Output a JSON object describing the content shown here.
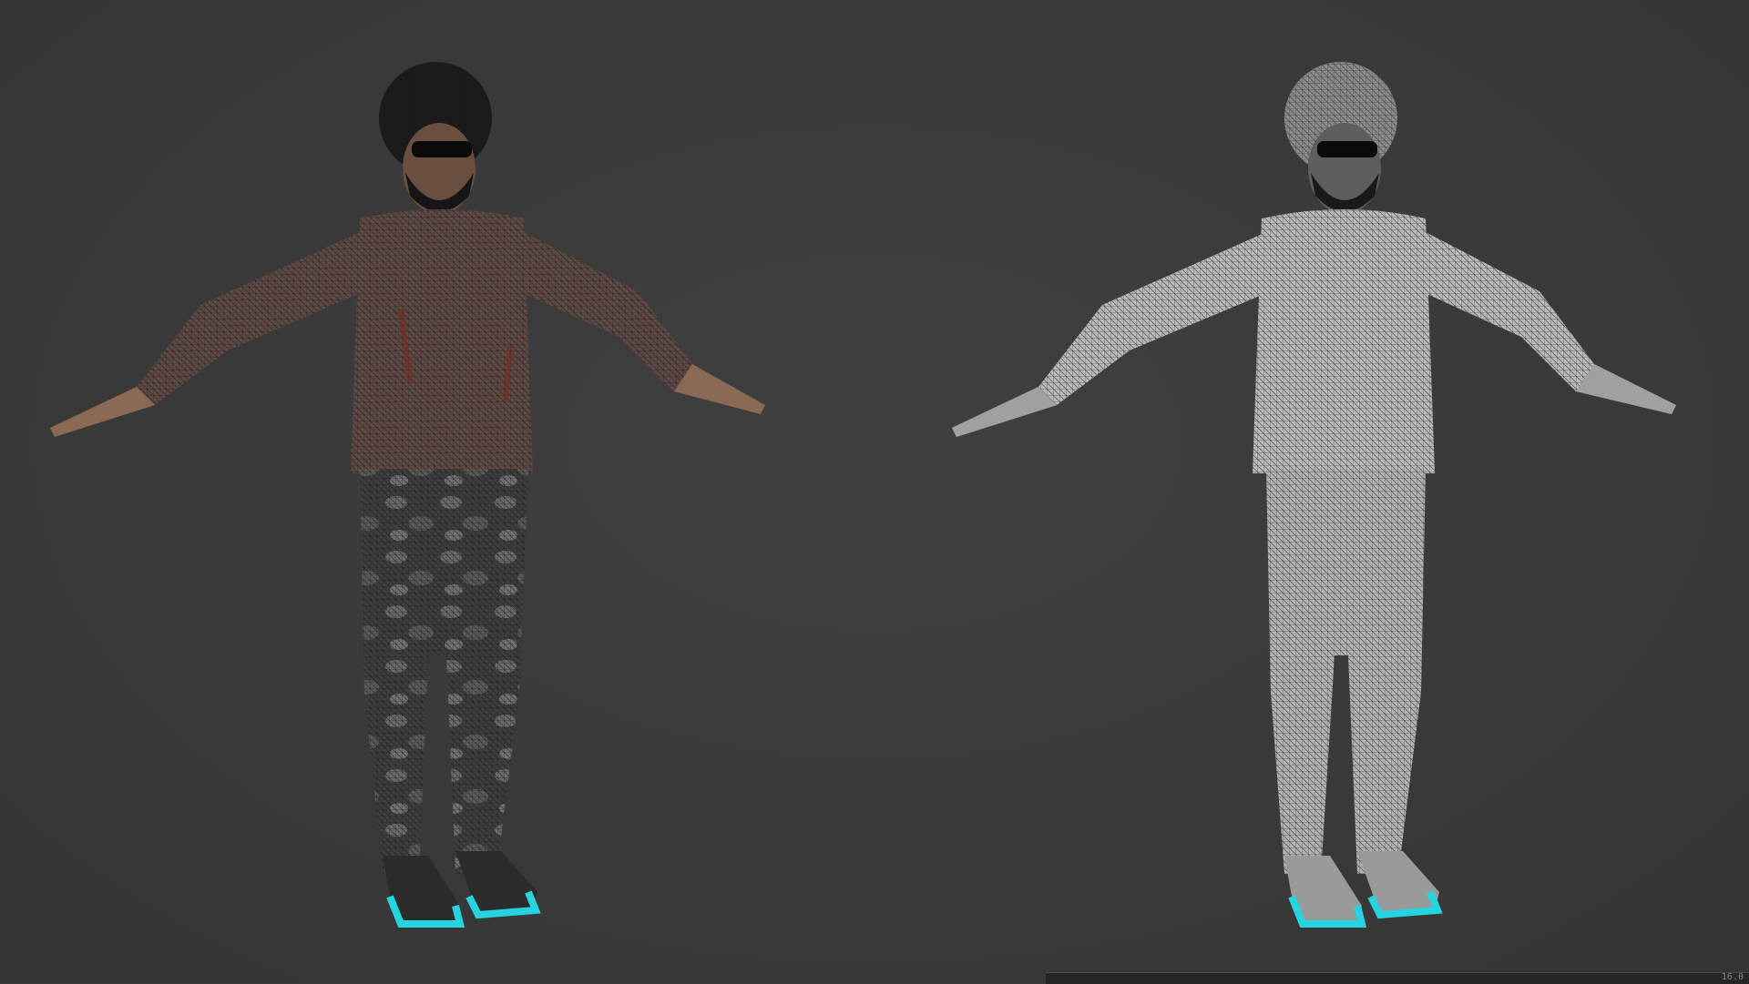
{
  "viewport": {
    "background": "#3b3b3b"
  },
  "models": [
    {
      "name": "textured-wireframe",
      "shirt_color": "#5e4a43",
      "pants_color": "#3e3e3e",
      "skin_color": "#8a6a55",
      "wire_color": "#1e1e1e",
      "hair_color": "#1a1a1a",
      "shoe_color": "#2c2c2c",
      "sole_color": "#26d4e0"
    },
    {
      "name": "clay-wireframe",
      "shirt_color": "#b9b9b9",
      "pants_color": "#b2b2b2",
      "skin_color": "#a8a8a8",
      "wire_color": "#3a3a3a",
      "hair_color": "#7a7a7a",
      "shoe_color": "#9a9a9a",
      "sole_color": "#26d4e0"
    }
  ],
  "status_bar": {
    "text": "16.0"
  }
}
